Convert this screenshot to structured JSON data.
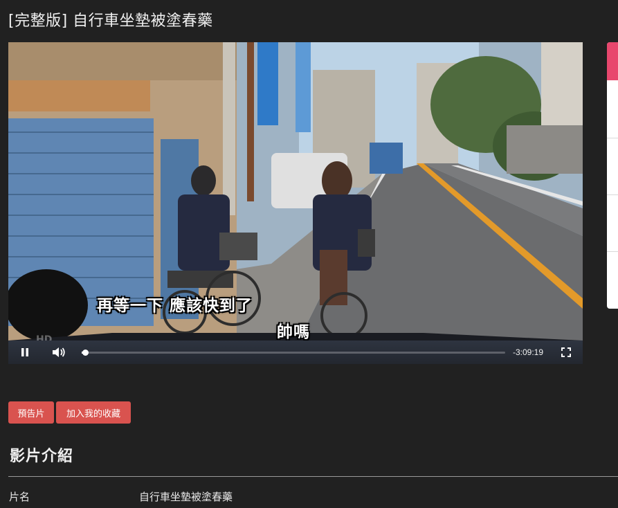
{
  "page": {
    "title": "[完整版] 自行車坐墊被塗春藥"
  },
  "player": {
    "subtitle_line1": "再等一下 應該快到了",
    "subtitle_line2": "帥嗎",
    "watermark": "HD",
    "time_remaining": "-3:09:19",
    "progress_fraction": 0.008,
    "state": "playing"
  },
  "actions": {
    "trailer_label": "預告片",
    "favorite_label": "加入我的收藏"
  },
  "details": {
    "section_title": "影片介紹",
    "rows": [
      {
        "label": "片名",
        "value": "自行車坐墊被塗春藥"
      }
    ]
  },
  "colors": {
    "background": "#212121",
    "button": "#d9534f",
    "side_accent": "#e8476d"
  },
  "icons": {
    "play_pause": "pause-icon",
    "volume": "volume-icon",
    "fullscreen": "fullscreen-icon"
  }
}
